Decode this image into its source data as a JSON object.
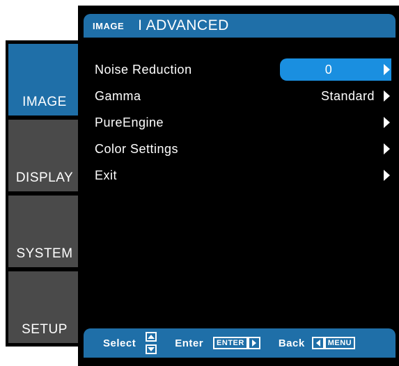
{
  "tabs": [
    {
      "label": "IMAGE",
      "active": true
    },
    {
      "label": "DISPLAY",
      "active": false
    },
    {
      "label": "SYSTEM",
      "active": false
    },
    {
      "label": "SETUP",
      "active": false
    }
  ],
  "header": {
    "section": "IMAGE",
    "subsection": "I ADVANCED"
  },
  "menu": [
    {
      "label": "Noise Reduction",
      "value": "0",
      "selected": true
    },
    {
      "label": "Gamma",
      "value": "Standard",
      "selected": false
    },
    {
      "label": "PureEngine",
      "value": "",
      "selected": false
    },
    {
      "label": "Color Settings",
      "value": "",
      "selected": false
    },
    {
      "label": "Exit",
      "value": "",
      "selected": false
    }
  ],
  "footer": {
    "select_label": "Select",
    "enter_label": "Enter",
    "enter_key": "ENTER",
    "back_label": "Back",
    "menu_key": "MENU"
  },
  "colors": {
    "accent": "#1f6fa8",
    "highlight": "#1a8fe0",
    "tab_inactive": "#4a4a4a",
    "background": "#000000"
  },
  "icons": {
    "arrow": "chevron-right-icon",
    "updown": "up-down-arrow-icon"
  }
}
